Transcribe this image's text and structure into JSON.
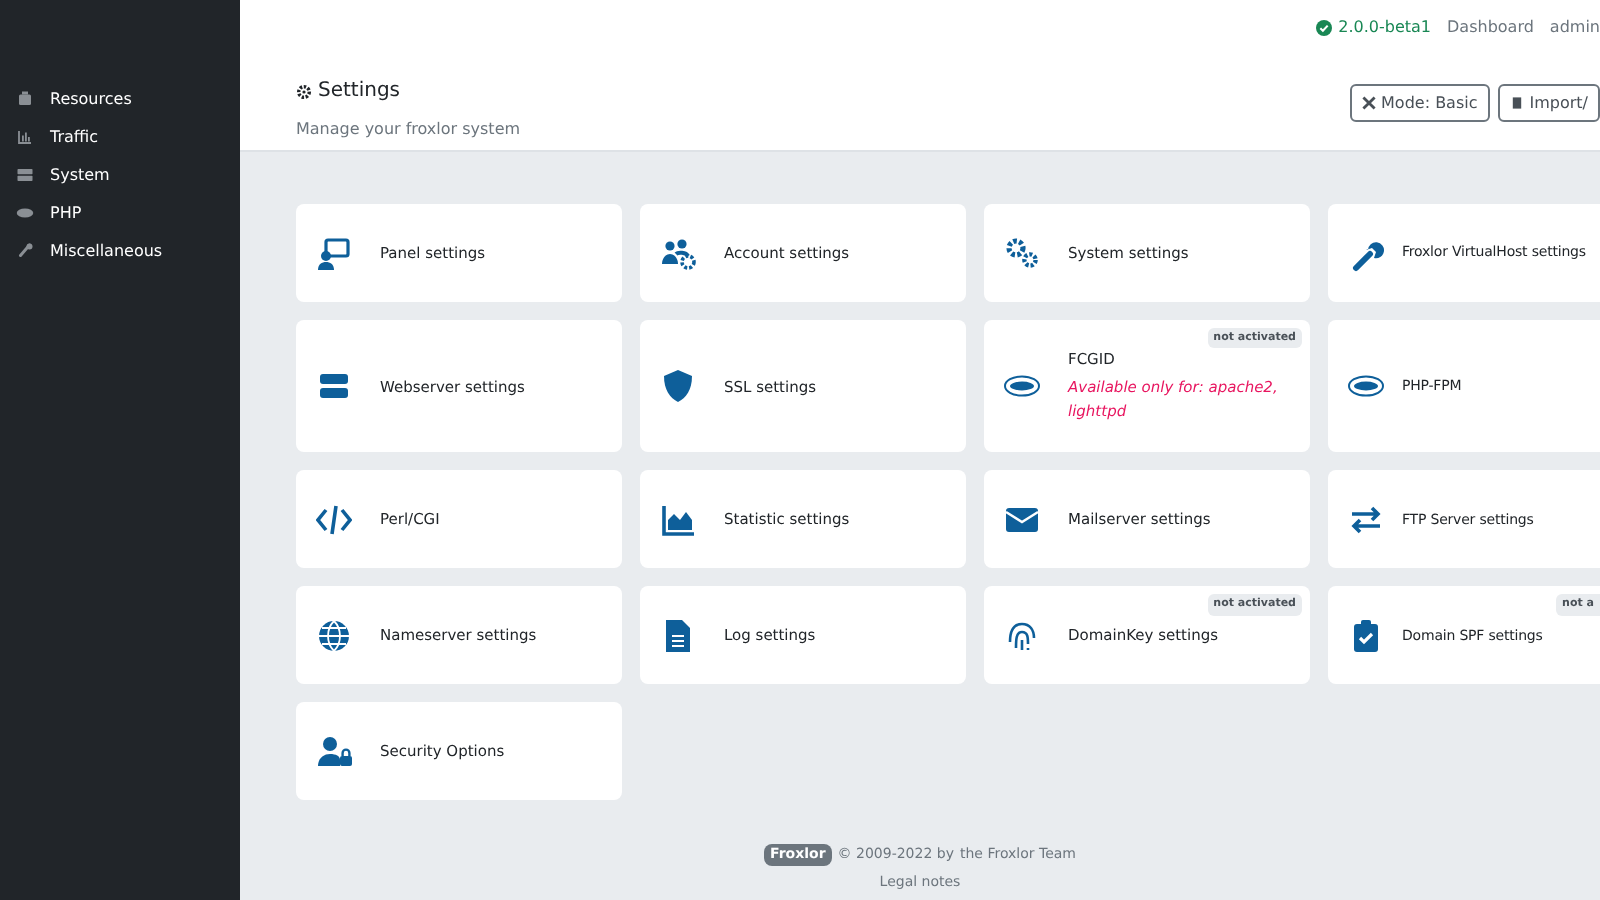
{
  "sidebar": {
    "items": [
      {
        "label": "Resources"
      },
      {
        "label": "Traffic"
      },
      {
        "label": "System"
      },
      {
        "label": "PHP"
      },
      {
        "label": "Miscellaneous"
      }
    ]
  },
  "topbar": {
    "version": "2.0.0-beta1",
    "links": [
      "Dashboard",
      "admin"
    ]
  },
  "header": {
    "title": "Settings",
    "subtitle": "Manage your froxlor system",
    "buttons": [
      "Mode: Basic",
      "Import/"
    ]
  },
  "cards": [
    {
      "label": "Panel settings"
    },
    {
      "label": "Account settings"
    },
    {
      "label": "System settings"
    },
    {
      "label": "Froxlor VirtualHost settings"
    },
    {
      "label": "Webserver settings"
    },
    {
      "label": "SSL settings"
    },
    {
      "label": "FCGID",
      "note": "Available only for: apache2, lighttpd",
      "badge": "not activated"
    },
    {
      "label": "PHP-FPM"
    },
    {
      "label": "Perl/CGI"
    },
    {
      "label": "Statistic settings"
    },
    {
      "label": "Mailserver settings"
    },
    {
      "label": "FTP Server settings"
    },
    {
      "label": "Nameserver settings"
    },
    {
      "label": "Log settings"
    },
    {
      "label": "DomainKey settings",
      "badge": "not activated"
    },
    {
      "label": "Domain SPF settings",
      "badge": "not a"
    },
    {
      "label": "Security Options"
    }
  ],
  "footer": {
    "brand": "Froxlor",
    "copyright": "© 2009-2022 by",
    "team": "the Froxlor Team",
    "legal": "Legal notes"
  }
}
